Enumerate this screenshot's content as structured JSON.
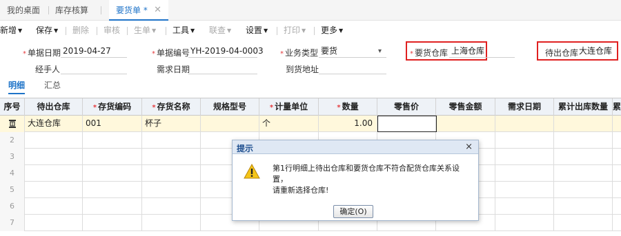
{
  "tabs": {
    "home": "我的桌面",
    "inventory_check": "库存核算",
    "requisition": "要货单 *",
    "close_symbol": "✕"
  },
  "toolbar": {
    "new": "新增",
    "save": "保存",
    "delete": "删除",
    "audit": "审核",
    "generate": "生单",
    "tools": "工具",
    "linked_query": "联查",
    "settings": "设置",
    "print": "打印",
    "more": "更多"
  },
  "form": {
    "doc_date_label": "单据日期",
    "doc_date_value": "2019-04-27",
    "doc_no_label": "单据编号",
    "doc_no_value": "YH-2019-04-0003",
    "biz_type_label": "业务类型",
    "biz_type_value": "要货",
    "req_wh_label": "要货仓库",
    "req_wh_value": "上海仓库",
    "out_wh_label": "待出仓库",
    "out_wh_value": "大连仓库",
    "handler_label": "经手人",
    "handler_value": "",
    "need_date_label": "需求日期",
    "need_date_value": "",
    "arrival_addr_label": "到货地址",
    "arrival_addr_value": ""
  },
  "subtabs": {
    "detail": "明细",
    "summary": "汇总"
  },
  "grid": {
    "headers": [
      "序号",
      "待出仓库",
      "存货编码",
      "存货名称",
      "规格型号",
      "计量单位",
      "数量",
      "零售价",
      "零售金额",
      "需求日期",
      "累计出库数量",
      "累"
    ],
    "row1": {
      "warehouse": "大连仓库",
      "code": "001",
      "name": "杯子",
      "unit": "个",
      "qty": "1.00"
    },
    "row_numbers": [
      "2",
      "3",
      "4",
      "5",
      "6",
      "7"
    ]
  },
  "dialog": {
    "title": "提示",
    "close": "×",
    "message_line1": "第1行明细上待出仓库和要货仓库不符合配货仓库关系设置，",
    "message_line2": "请重新选择仓库!",
    "ok_button": "确定(O)",
    "icon": "warning-icon"
  }
}
